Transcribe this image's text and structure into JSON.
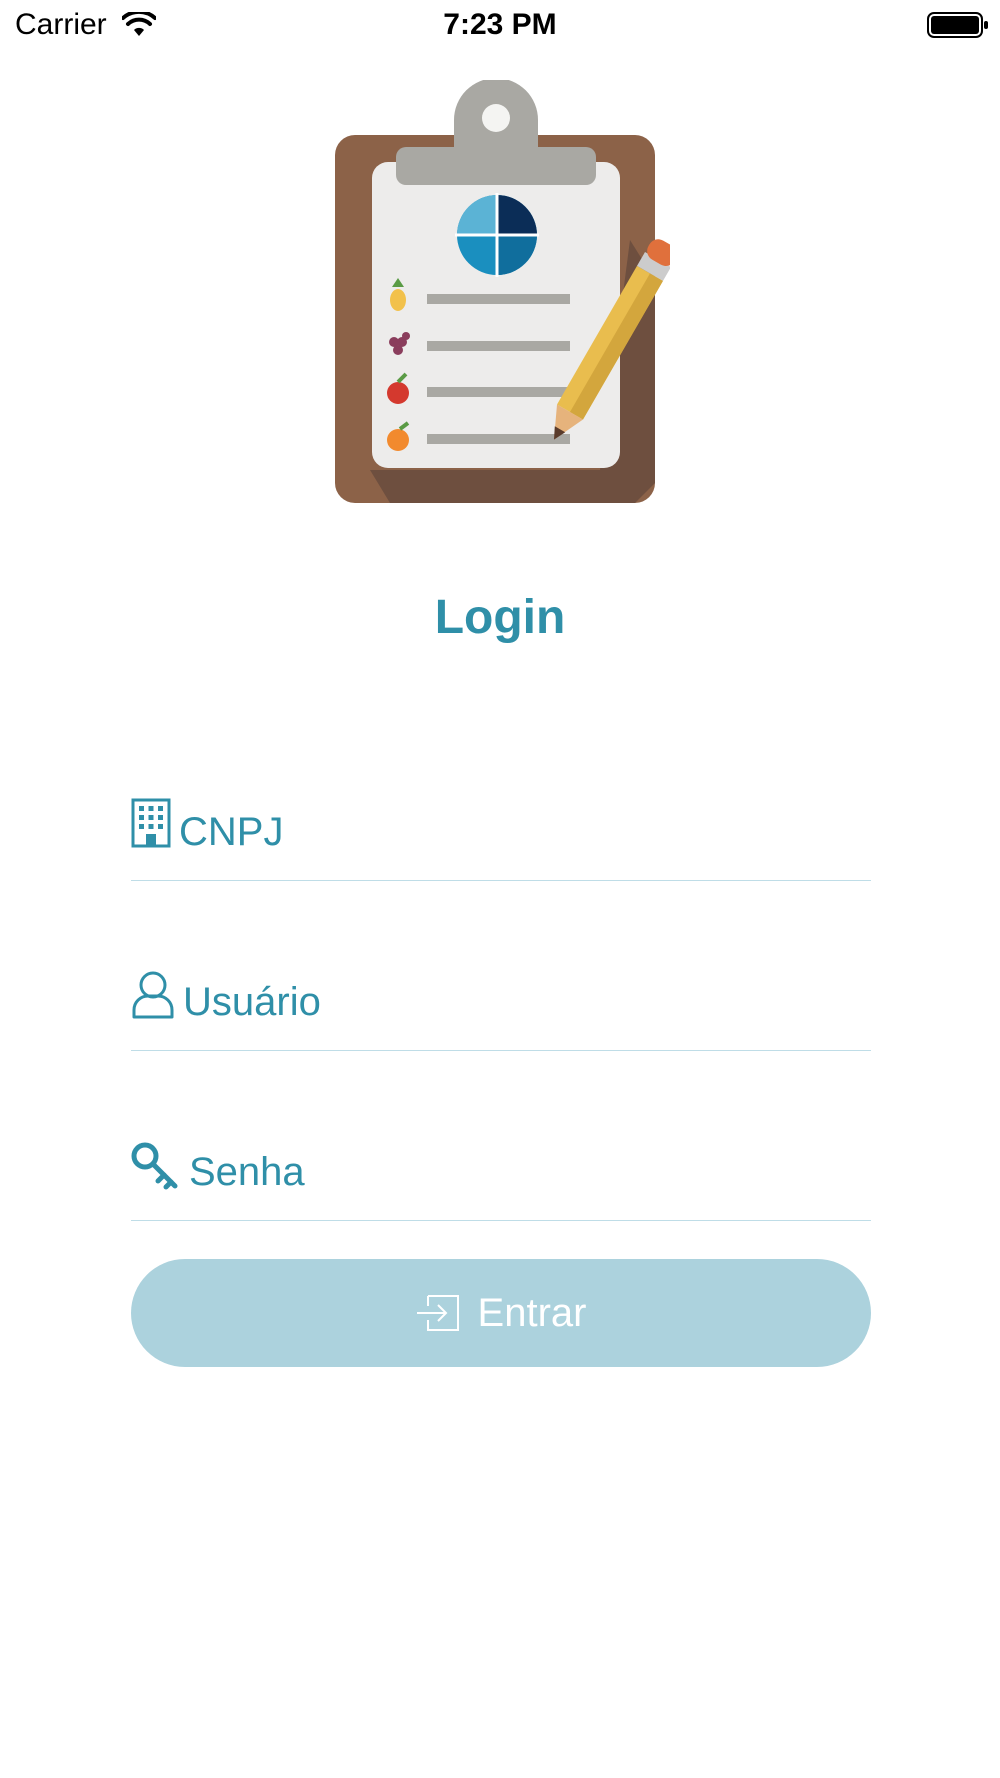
{
  "status_bar": {
    "carrier": "Carrier",
    "time": "7:23 PM",
    "wifi_icon": "wifi-icon",
    "battery_icon": "battery-icon"
  },
  "logo": {
    "icon": "clipboard-checklist-logo"
  },
  "title": "Login",
  "form": {
    "cnpj": {
      "placeholder": "CNPJ",
      "value": "",
      "icon": "building-icon"
    },
    "user": {
      "placeholder": "Usuário",
      "value": "",
      "icon": "user-icon"
    },
    "password": {
      "placeholder": "Senha",
      "value": "",
      "icon": "key-icon"
    }
  },
  "submit": {
    "label": "Entrar",
    "icon": "login-enter-icon"
  },
  "colors": {
    "accent": "#2f8fa8",
    "button_bg": "#acd2dd",
    "divider": "#bfdde7"
  }
}
